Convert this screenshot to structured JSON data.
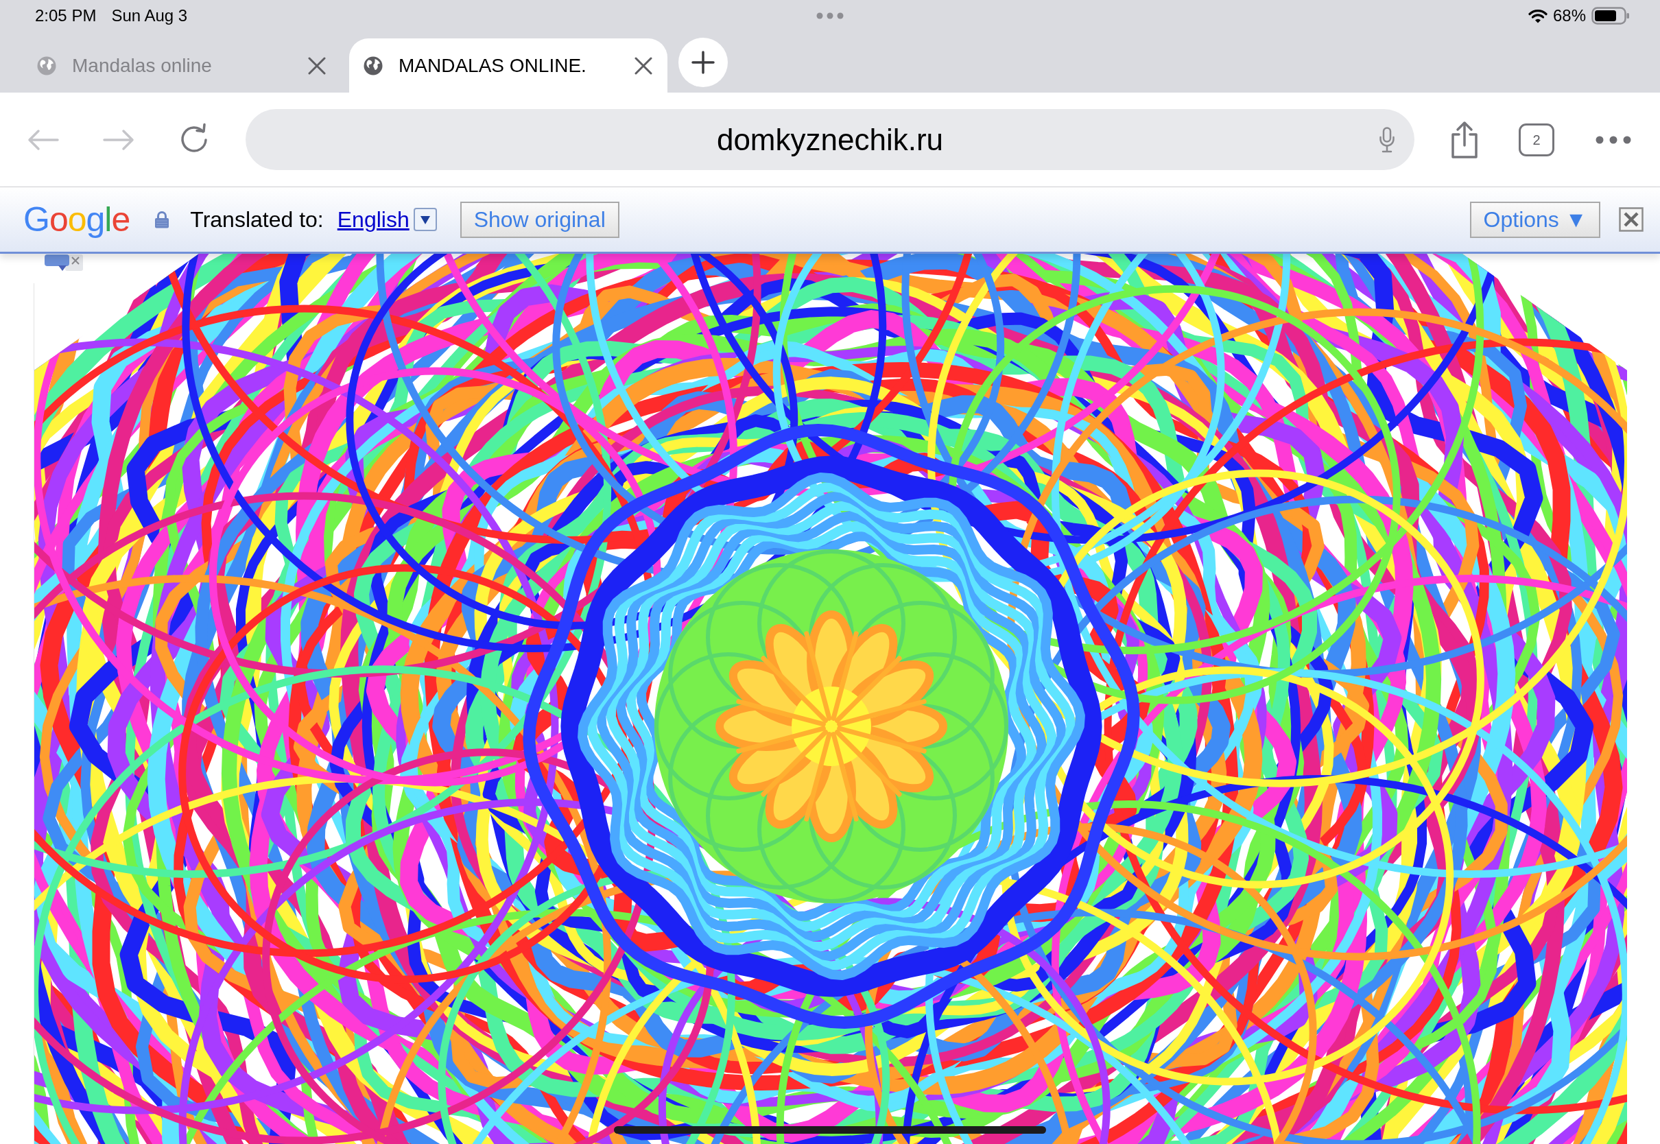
{
  "status_bar": {
    "time": "2:05 PM",
    "date": "Sun Aug 3",
    "battery": "68%"
  },
  "tabs": [
    {
      "title": "Mandalas online",
      "selected": false
    },
    {
      "title": "MANDALAS ONLINE.",
      "selected": true
    }
  ],
  "toolbar": {
    "back": {
      "disabled": true
    },
    "forward": {
      "disabled": true
    },
    "url": "domkyznechik.ru",
    "tab_count": "2"
  },
  "translate_bar": {
    "logo": "Google",
    "label": "Translated to:",
    "language": "English",
    "show_original": "Show original",
    "options": "Options ▼"
  }
}
